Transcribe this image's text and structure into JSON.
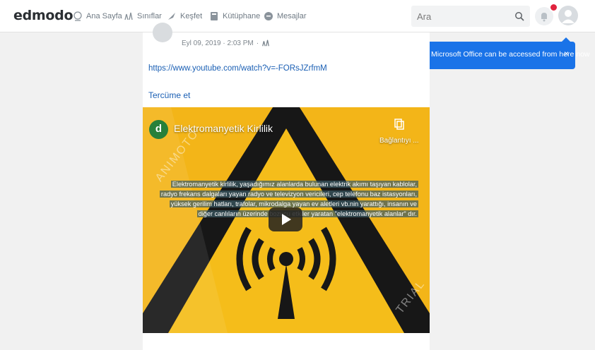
{
  "app": {
    "logo": "edmodo"
  },
  "nav": {
    "items": [
      {
        "label": "Ana Sayfa",
        "icon": "home-icon"
      },
      {
        "label": "Sınıflar",
        "icon": "classes-icon"
      },
      {
        "label": "Keşfet",
        "icon": "rocket-icon"
      },
      {
        "label": "Kütüphane",
        "icon": "library-icon"
      },
      {
        "label": "Mesajlar",
        "icon": "messages-icon"
      }
    ]
  },
  "search": {
    "placeholder": "Ara"
  },
  "tooltip": {
    "text": "Microsoft Office can be accessed from here now",
    "close": "×"
  },
  "post": {
    "date": "Eyl 09, 2019 · 2:03 PM",
    "sep": "·",
    "url": "https://www.youtube.com/watch?v=-FORsJZrfmM",
    "translate": "Tercüme et",
    "video": {
      "badge": "d",
      "title": "Elektromanyetik Kirlilik",
      "copy_label": "Bağlantıyı ...",
      "caption": [
        "Elektromanyetik kirlilik, yaşadığımız alanlarda bulunan elektrik akımı taşıyan kablolar,",
        "radyo frekans dalgaları yayan radyo ve televizyon vericileri, cep telefonu baz istasyonları,",
        "yüksek gerilim hatları, trafolar, mikrodalga yayan ev aletleri vb.nin yarattığı, insanın ve",
        "diğer canlıların üzerinde bozucu etkiler yaratan \"elektromanyetik alanlar\" dır."
      ],
      "watermark_left": "ANIMOTO",
      "watermark_right": "TRIAL"
    }
  },
  "colors": {
    "accent": "#1a73e8",
    "link": "#1a5fb4",
    "alert": "#e0233e",
    "video_bg": "#f3b518"
  }
}
